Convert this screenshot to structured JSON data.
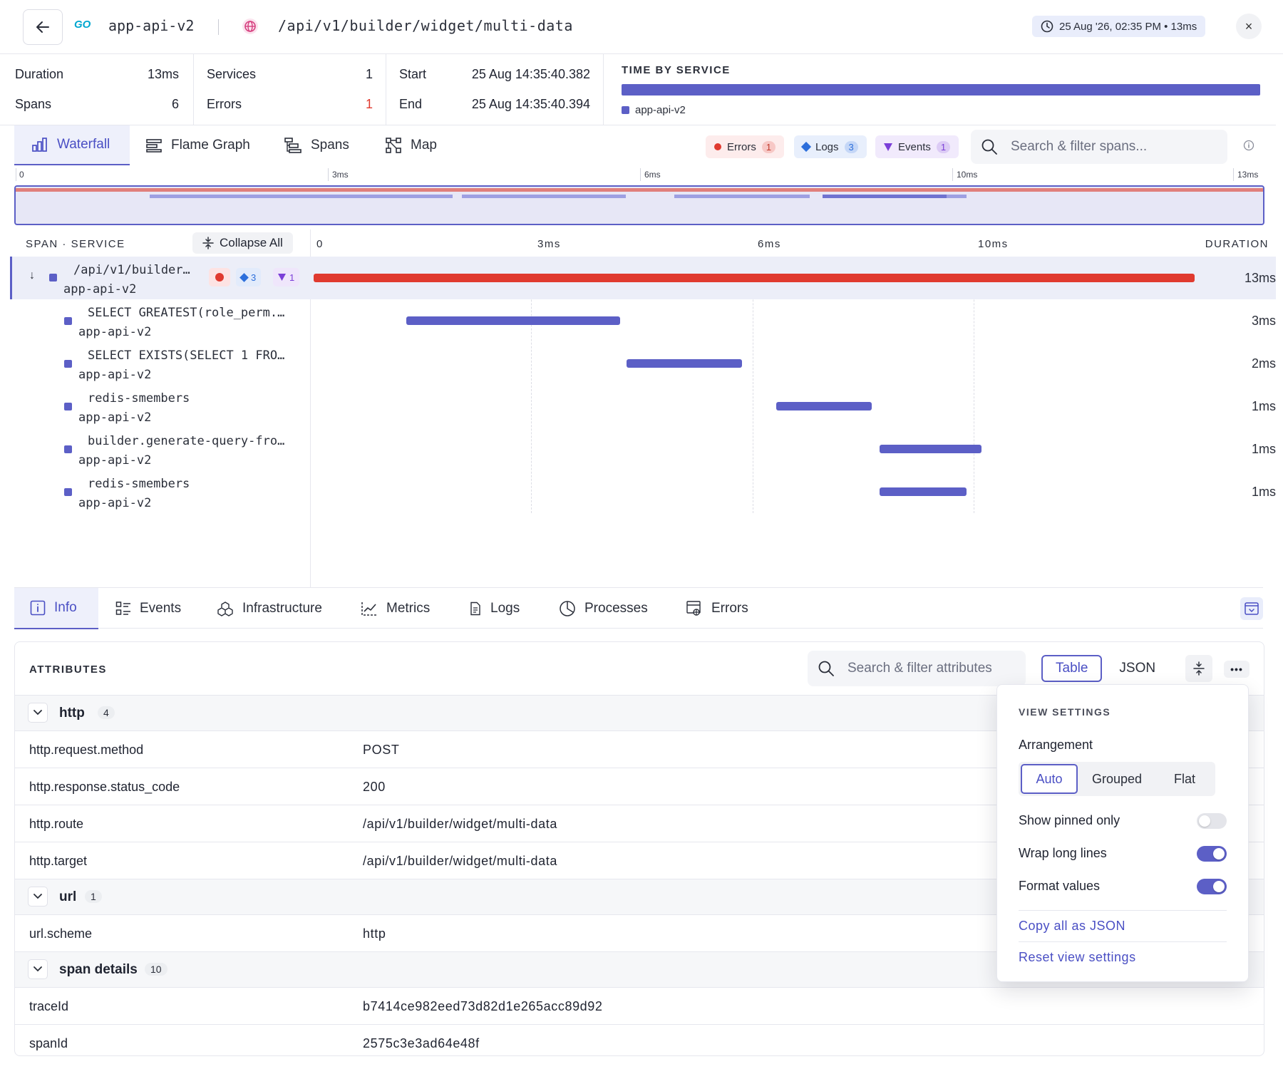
{
  "header": {
    "go_logo": "GO",
    "service": "app-api-v2",
    "endpoint": "/api/v1/builder/widget/multi-data",
    "time_chip": "25 Aug '26, 02:35 PM • 13ms",
    "close": "×"
  },
  "stats": {
    "duration_label": "Duration",
    "duration_value": "13ms",
    "spans_label": "Spans",
    "spans_value": "6",
    "services_label": "Services",
    "services_value": "1",
    "errors_label": "Errors",
    "errors_value": "1",
    "start_label": "Start",
    "start_value": "25 Aug 14:35:40.382",
    "end_label": "End",
    "end_value": "25 Aug 14:35:40.394"
  },
  "time_by_service": {
    "title": "TIME BY SERVICE",
    "services": [
      {
        "name": "app-api-v2",
        "color": "#5c5fc6",
        "share": 1.0
      }
    ]
  },
  "view_tabs": [
    "Waterfall",
    "Flame Graph",
    "Spans",
    "Map"
  ],
  "active_view_tab": "Waterfall",
  "filters": {
    "errors_label": "Errors",
    "errors_count": "1",
    "logs_label": "Logs",
    "logs_count": "3",
    "events_label": "Events",
    "events_count": "1"
  },
  "span_search": {
    "placeholder": "Search & filter spans..."
  },
  "minimap_ticks": [
    "0",
    "3ms",
    "6ms",
    "10ms",
    "13ms"
  ],
  "span_table": {
    "header": "SPAN · SERVICE",
    "collapse_all": "Collapse All",
    "timeline_ticks": [
      "0",
      "3ms",
      "6ms",
      "10ms"
    ],
    "duration_header": "DURATION"
  },
  "root_span": {
    "name": "/api/v1/builder…",
    "service": "app-api-v2",
    "badge_logs": "3",
    "badge_events": "1",
    "duration": "13ms"
  },
  "child_spans": [
    {
      "name": "SELECT GREATEST(role_perm.…",
      "service": "app-api-v2",
      "duration": "3ms"
    },
    {
      "name": "SELECT EXISTS(SELECT 1 FRO…",
      "service": "app-api-v2",
      "duration": "2ms"
    },
    {
      "name": "redis-smembers",
      "service": "app-api-v2",
      "duration": "1ms"
    },
    {
      "name": "builder.generate-query-fro…",
      "service": "app-api-v2",
      "duration": "1ms"
    },
    {
      "name": "redis-smembers",
      "service": "app-api-v2",
      "duration": "1ms"
    }
  ],
  "detail_tabs": [
    "Info",
    "Events",
    "Infrastructure",
    "Metrics",
    "Logs",
    "Processes",
    "Errors"
  ],
  "active_detail_tab": "Info",
  "attributes": {
    "title": "ATTRIBUTES",
    "search_placeholder": "Search & filter attributes",
    "view_table": "Table",
    "view_json": "JSON",
    "more": "•••",
    "groups": {
      "http": {
        "name": "http",
        "count": "4"
      },
      "url": {
        "name": "url",
        "count": "1"
      },
      "span": {
        "name": "span details",
        "count": "10"
      }
    },
    "rows": [
      {
        "key": "http.request.method",
        "value": "POST"
      },
      {
        "key": "http.response.status_code",
        "value": "200"
      },
      {
        "key": "http.route",
        "value": "/api/v1/builder/widget/multi-data"
      },
      {
        "key": "http.target",
        "value": "/api/v1/builder/widget/multi-data"
      },
      {
        "key": "url.scheme",
        "value": "http"
      },
      {
        "key": "traceId",
        "value": "b7414ce982eed73d82d1e265acc89d92"
      },
      {
        "key": "spanId",
        "value": "2575c3e3ad64e48f"
      }
    ]
  },
  "view_settings": {
    "title": "VIEW SETTINGS",
    "arrangement_label": "Arrangement",
    "arrangement_options": [
      "Auto",
      "Grouped",
      "Flat"
    ],
    "arrangement_selected": "Auto",
    "show_pinned_label": "Show pinned only",
    "show_pinned": false,
    "wrap_label": "Wrap long lines",
    "wrap": true,
    "format_label": "Format values",
    "format": true,
    "copy_json": "Copy all as JSON",
    "reset": "Reset view settings"
  },
  "colors": {
    "accent": "#5c5fc6",
    "error": "#e03a2f",
    "logs": "#2d6fdb",
    "events": "#7b3fd8"
  }
}
